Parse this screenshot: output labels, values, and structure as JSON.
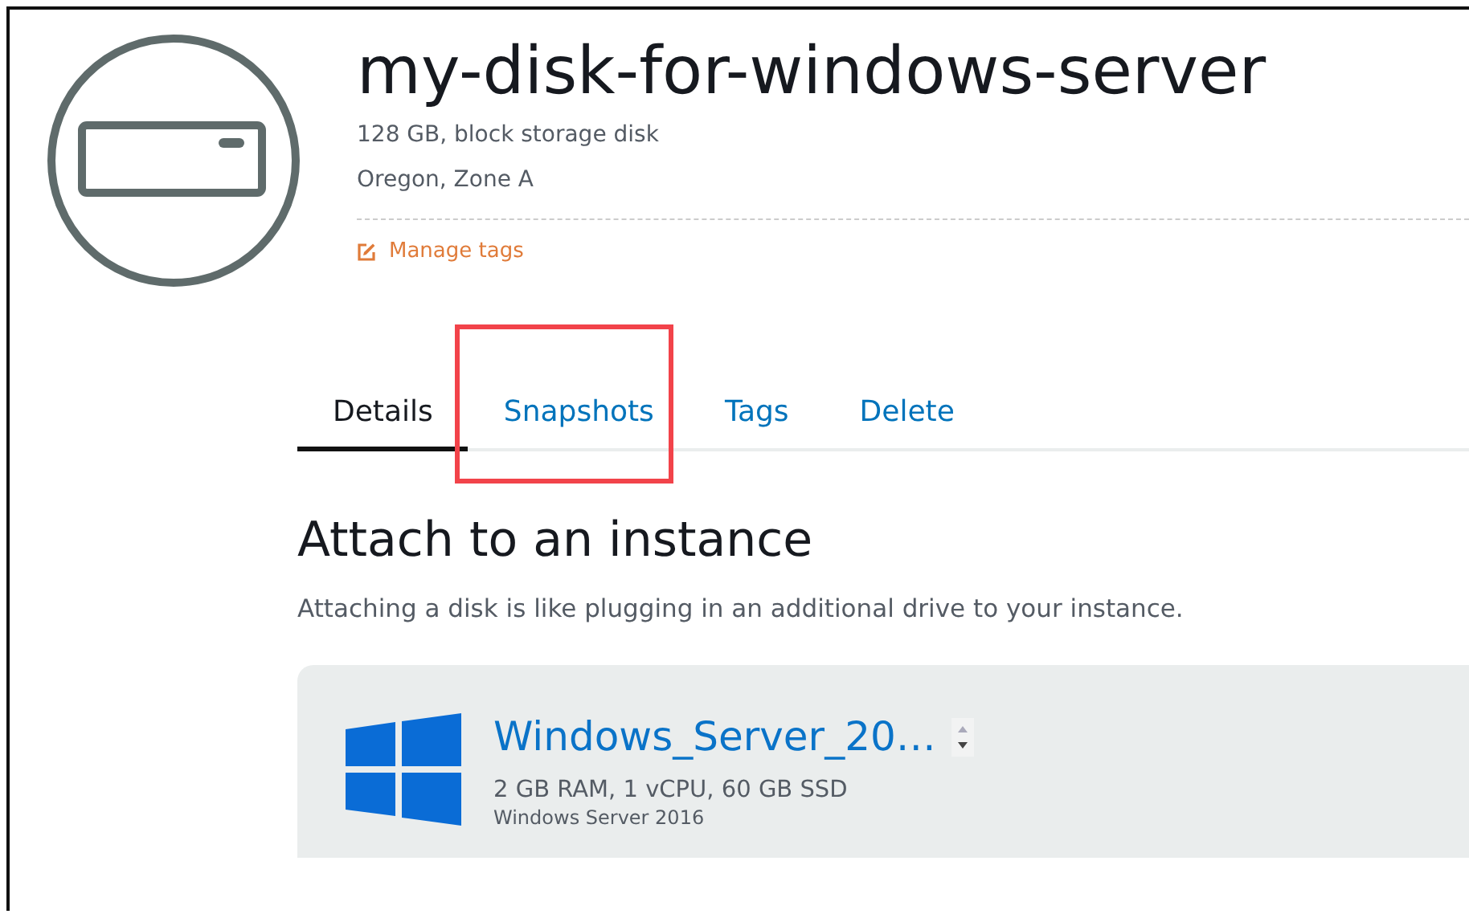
{
  "disk": {
    "name": "my-disk-for-windows-server",
    "size": "128 GB, block storage disk",
    "location": "Oregon, Zone A",
    "manage_tags": "Manage tags"
  },
  "tabs": [
    {
      "label": "Details",
      "selected": true,
      "highlighted": false
    },
    {
      "label": "Snapshots",
      "selected": false,
      "highlighted": true
    },
    {
      "label": "Tags",
      "selected": false,
      "highlighted": false
    },
    {
      "label": "Delete",
      "selected": false,
      "highlighted": false
    }
  ],
  "attach": {
    "heading": "Attach to an instance",
    "description": "Attaching a disk is like plugging in an additional drive to your instance.",
    "instance": {
      "name": "Windows_Server_20…",
      "specs": "2 GB RAM, 1 vCPU, 60 GB SSD",
      "os": "Windows Server 2016"
    }
  }
}
